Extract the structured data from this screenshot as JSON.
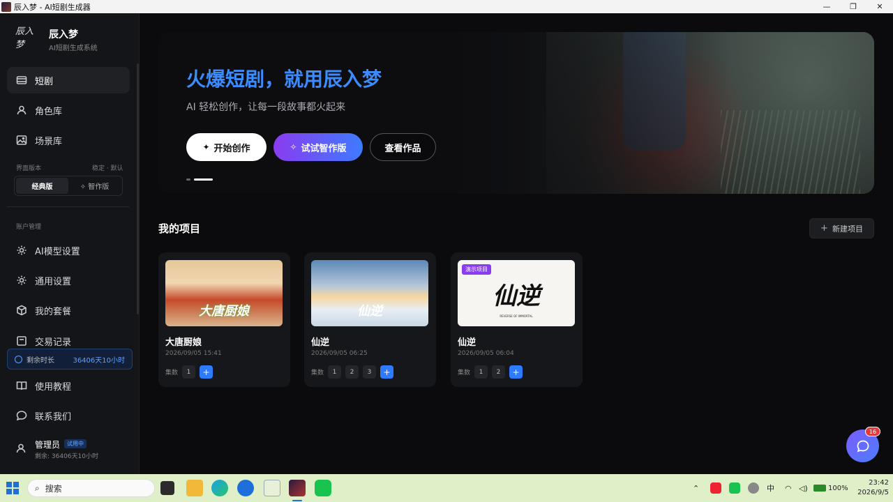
{
  "window": {
    "title": "辰入梦 - AI短剧生成器",
    "minimize": "—",
    "maximize": "❐",
    "close": "✕"
  },
  "brand": {
    "logo": "辰入梦",
    "name": "辰入梦",
    "subtitle": "AI短剧生成系统"
  },
  "sidebar": {
    "items": [
      {
        "label": "短剧",
        "icon": "film-icon",
        "active": true
      },
      {
        "label": "角色库",
        "icon": "user-icon"
      },
      {
        "label": "场景库",
        "icon": "image-icon"
      }
    ],
    "version": {
      "label": "界面版本",
      "hint": "稳定 · 默认",
      "options": [
        "经典版",
        "✧ 智作版"
      ],
      "selected": "经典版"
    },
    "account_label": "账户管理",
    "account_items": [
      {
        "label": "AI模型设置",
        "icon": "gear-icon"
      },
      {
        "label": "通用设置",
        "icon": "settings-icon"
      },
      {
        "label": "我的套餐",
        "icon": "box-icon"
      },
      {
        "label": "交易记录",
        "icon": "receipt-icon"
      }
    ],
    "time": {
      "label": "剩余时长",
      "value": "36406天10小时"
    },
    "bottom_items": [
      {
        "label": "使用教程",
        "icon": "book-icon"
      },
      {
        "label": "联系我们",
        "icon": "chat-icon"
      }
    ],
    "user": {
      "name": "管理员",
      "badge": "试用中",
      "sub": "剩余: 36406天10小时"
    }
  },
  "hero": {
    "title": "火爆短剧，就用辰入梦",
    "subtitle": "AI 轻松创作，让每一段故事都火起来",
    "buttons": {
      "start": "开始创作",
      "try": "试试智作版",
      "view": "查看作品"
    }
  },
  "projects": {
    "title": "我的项目",
    "new_button": "新建项目",
    "episodes_label": "集数",
    "cards": [
      {
        "title": "大唐厨娘",
        "date": "2026/09/05 15:41",
        "thumb_text": "大唐厨娘",
        "episodes": [
          "1"
        ],
        "demo": false
      },
      {
        "title": "仙逆",
        "date": "2026/09/05 06:25",
        "thumb_text": "仙逆",
        "episodes": [
          "1",
          "2",
          "3"
        ],
        "demo": false
      },
      {
        "title": "仙逆",
        "date": "2026/09/05 06:04",
        "thumb_text": "仙逆",
        "thumb_small": "REVERSE OF IMMORTAL",
        "episodes": [
          "1",
          "2"
        ],
        "demo": true,
        "demo_label": "演示项目"
      }
    ]
  },
  "chat": {
    "badge": "16"
  },
  "taskbar": {
    "search": "搜索",
    "tray": {
      "ime": "中",
      "battery": "100%"
    },
    "time": "23:42",
    "date": "2026/9/5"
  },
  "colors": {
    "accent": "#3b8cff",
    "purple": "#8a3cf0",
    "sidebar": "#141518",
    "taskbar": "#dff0c9"
  }
}
